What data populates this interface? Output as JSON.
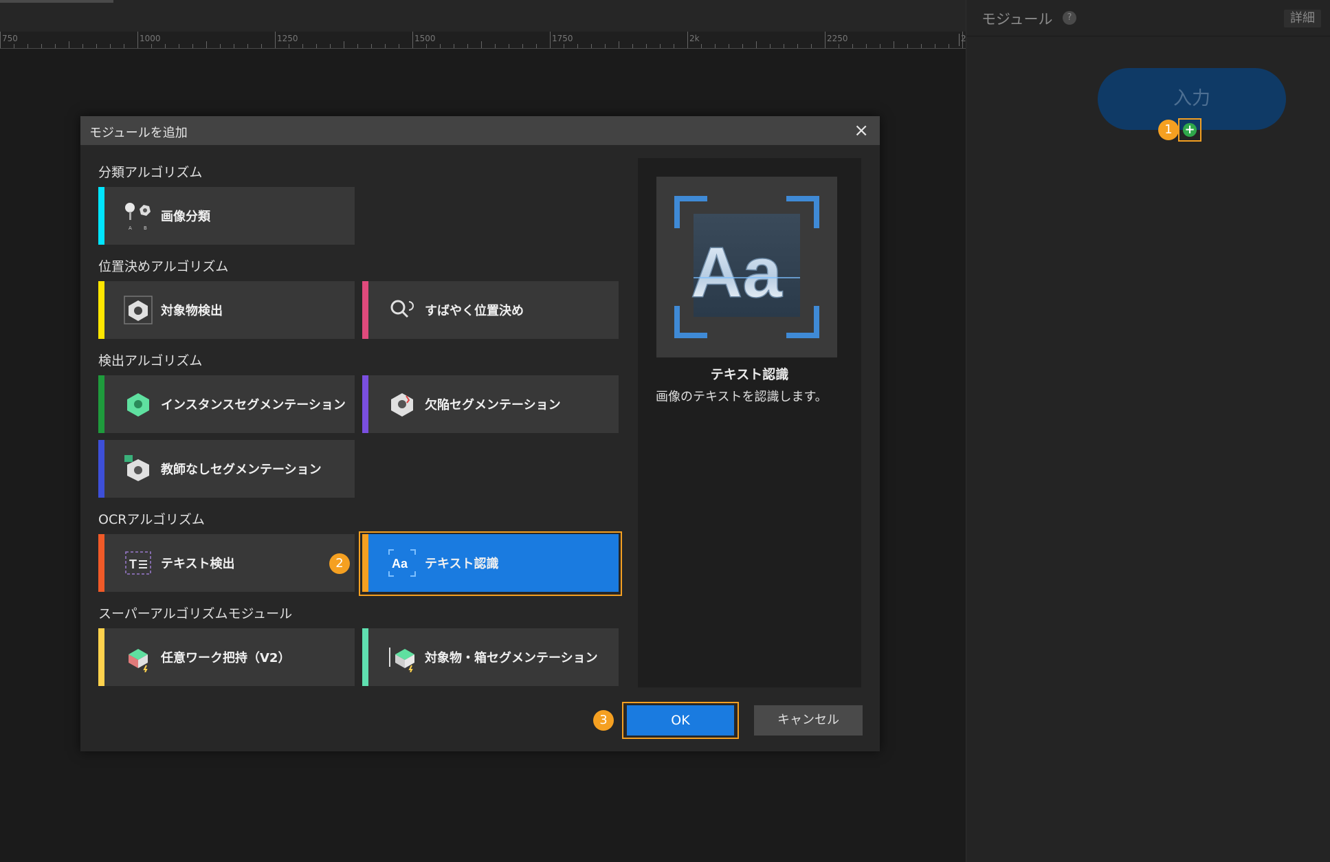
{
  "ruler": {
    "labels": [
      "750",
      "1000",
      "1250",
      "1500",
      "1750",
      "2k",
      "2250",
      "2"
    ]
  },
  "right_panel": {
    "title": "モジュール",
    "help": "?",
    "details_button": "詳細",
    "input_node": "入力",
    "add_port": "+"
  },
  "badges": {
    "step1": "1",
    "step2": "2",
    "step3": "3"
  },
  "dialog": {
    "title": "モジュールを追加",
    "close": "×",
    "sections": {
      "classification": "分類アルゴリズム",
      "positioning": "位置決めアルゴリズム",
      "detection": "検出アルゴリズム",
      "ocr": "OCRアルゴリズム",
      "super": "スーパーアルゴリズムモジュール"
    },
    "modules": {
      "image_classification": "画像分類",
      "object_detection": "対象物検出",
      "fast_positioning": "すばやく位置決め",
      "instance_segmentation": "インスタンスセグメンテーション",
      "defect_segmentation": "欠陥セグメンテーション",
      "unsupervised_segmentation": "教師なしセグメンテーション",
      "text_detection": "テキスト検出",
      "text_recognition": "テキスト認識",
      "arbitrary_picking": "任意ワーク把持（V2）",
      "object_box_segmentation": "対象物・箱セグメンテーション"
    },
    "preview": {
      "image_text": "Aa",
      "name": "テキスト認識",
      "description": "画像のテキストを認識します。"
    },
    "ok_button": "OK",
    "cancel_button": "キャンセル"
  },
  "colors": {
    "classification": "#00e5ff",
    "object_detection": "#ffe600",
    "fast_positioning": "#e04a7c",
    "instance_segmentation": "#1e9b3c",
    "defect_segmentation": "#7a4fe0",
    "unsupervised_segmentation": "#3d4fd8",
    "text_detection": "#f05a28",
    "text_recognition": "#f5a021",
    "arbitrary_picking": "#ffd24d",
    "object_box_segmentation": "#5fe0b0",
    "highlight": "#f5a021",
    "selected": "#1a7be0"
  }
}
